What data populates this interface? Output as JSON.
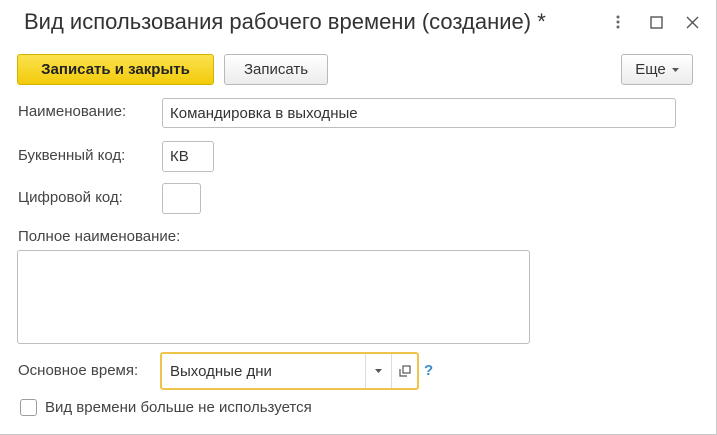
{
  "window": {
    "title": "Вид использования рабочего времени (создание) *",
    "more_icon": "more-vertical-icon",
    "maximize_icon": "maximize-icon",
    "close_icon": "close-icon"
  },
  "toolbar": {
    "save_close_label": "Записать и закрыть",
    "save_label": "Записать",
    "more_label": "Еще"
  },
  "form": {
    "name_label": "Наименование:",
    "name_value": "Командировка в выходные",
    "letter_code_label": "Буквенный код:",
    "letter_code_value": "КВ",
    "digit_code_label": "Цифровой код:",
    "digit_code_value": "",
    "full_name_label": "Полное наименование:",
    "full_name_value": "",
    "main_time_label": "Основное время:",
    "main_time_value": "Выходные дни",
    "help_mark": "?",
    "unused_label": "Вид времени больше не используется",
    "unused_checked": false
  },
  "colors": {
    "primary_button": "#f2cb0a",
    "focus_border": "#f0c44a",
    "help": "#3c8dc9"
  }
}
